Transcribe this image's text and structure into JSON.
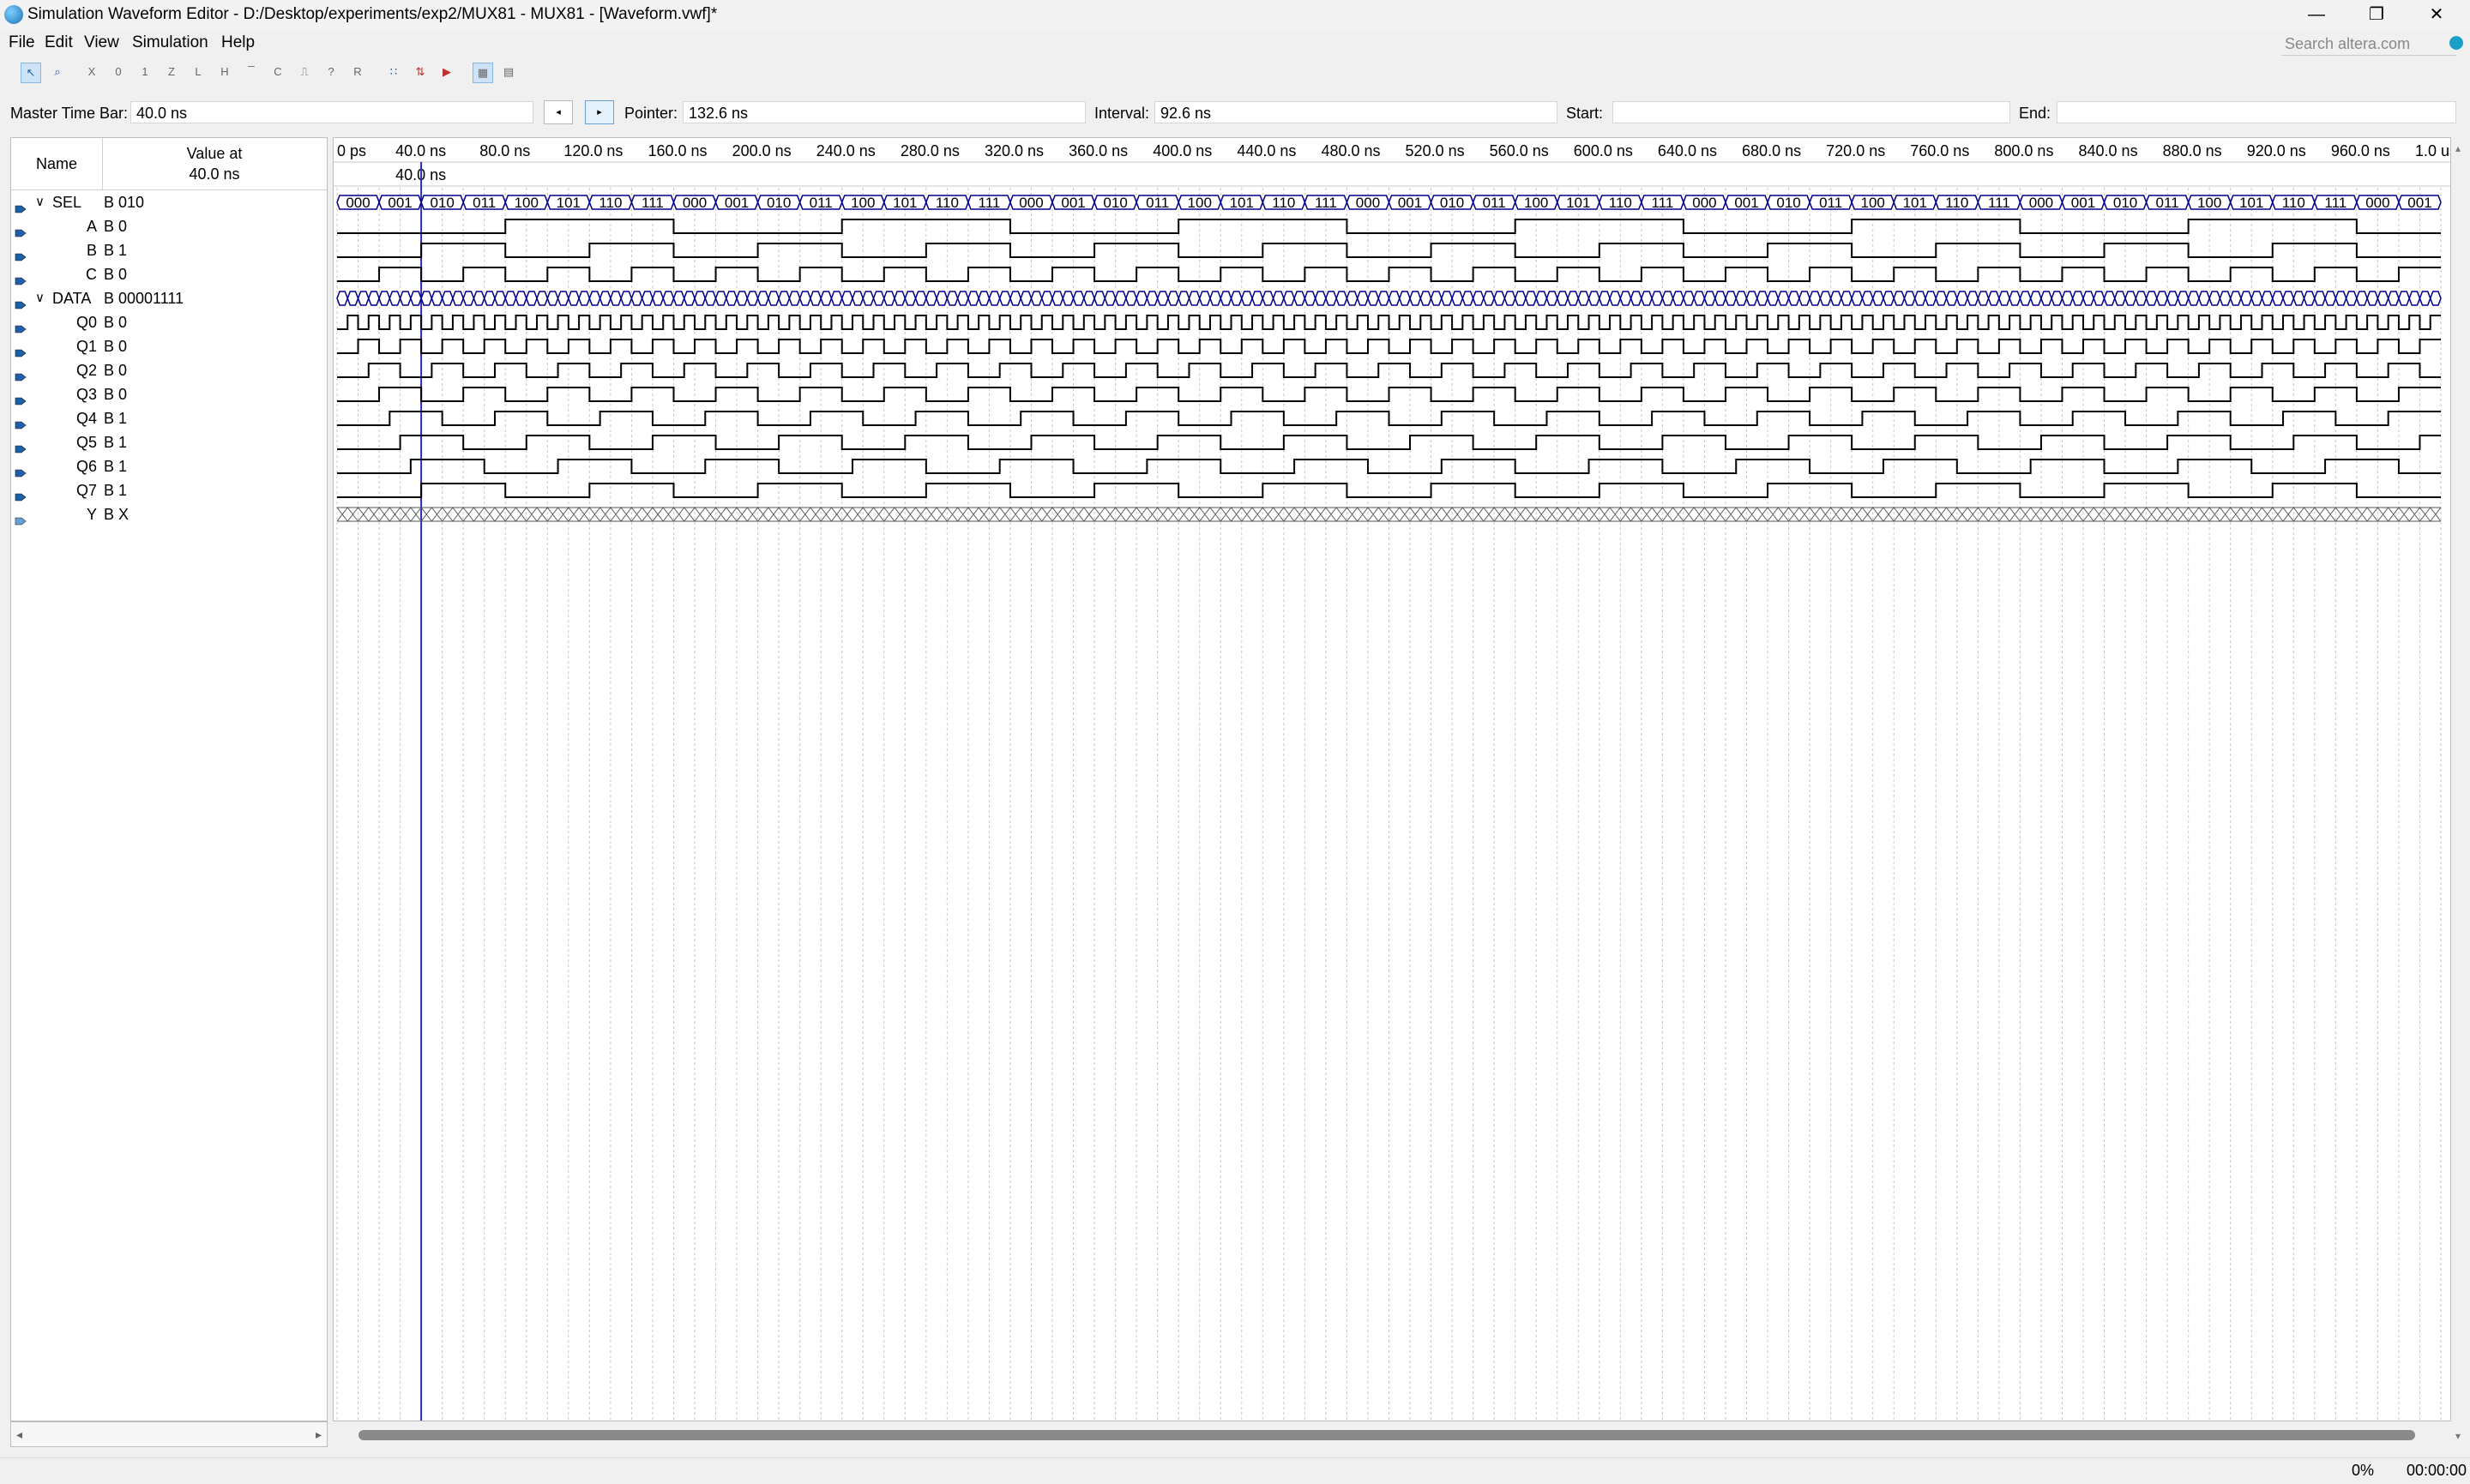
{
  "window": {
    "title": "Simulation Waveform Editor - D:/Desktop/experiments/exp2/MUX81 - MUX81 - [Waveform.vwf]*",
    "controls": [
      "—",
      "❐",
      "✕"
    ]
  },
  "menu": [
    "File",
    "Edit",
    "View",
    "Simulation",
    "Help"
  ],
  "search": {
    "placeholder": "Search altera.com"
  },
  "toolbar": {
    "icons": [
      "select-tool-icon",
      "zoom-tool-icon",
      "force-unknown-icon",
      "force-low-icon",
      "force-high-icon",
      "force-high-impedance-icon",
      "force-weak-low-icon",
      "force-weak-high-icon",
      "invert-icon",
      "count-value-icon",
      "clock-icon",
      "arbitrary-value-icon",
      "random-value-icon",
      "snap-to-grid-icon",
      "sort-icon",
      "functional-sim-icon",
      "timing-sim-icon",
      "netlist-sim-icon",
      "grid-icon",
      "group-icon"
    ]
  },
  "timebar": {
    "master_label": "Master Time Bar:",
    "master_value": "40.0 ns",
    "pointer_label": "Pointer:",
    "pointer_value": "132.6 ns",
    "interval_label": "Interval:",
    "interval_value": "92.6 ns",
    "start_label": "Start:",
    "start_value": "",
    "end_label": "End:",
    "end_value": "",
    "prev_glyph": "◂",
    "next_glyph": "▸"
  },
  "header": {
    "name": "Name",
    "value_at": "Value at",
    "value_time": "40.0 ns"
  },
  "signals": [
    {
      "name": "SEL",
      "value": "B 010",
      "group": true
    },
    {
      "name": "A",
      "value": "B 0"
    },
    {
      "name": "B",
      "value": "B 1"
    },
    {
      "name": "C",
      "value": "B 0"
    },
    {
      "name": "DATA",
      "value": "B 00001111",
      "group": true
    },
    {
      "name": "Q0",
      "value": "B 0"
    },
    {
      "name": "Q1",
      "value": "B 0"
    },
    {
      "name": "Q2",
      "value": "B 0"
    },
    {
      "name": "Q3",
      "value": "B 0"
    },
    {
      "name": "Q4",
      "value": "B 1"
    },
    {
      "name": "Q5",
      "value": "B 1"
    },
    {
      "name": "Q6",
      "value": "B 1"
    },
    {
      "name": "Q7",
      "value": "B 1"
    },
    {
      "name": "Y",
      "value": "B X"
    }
  ],
  "time_axis": {
    "labels": [
      "0 ps",
      "40.0 ns",
      "80.0 ns",
      "120.0 ns",
      "160.0 ns",
      "200.0 ns",
      "240.0 ns",
      "280.0 ns",
      "320.0 ns",
      "360.0 ns",
      "400.0 ns",
      "440.0 ns",
      "480.0 ns",
      "520.0 ns",
      "560.0 ns",
      "600.0 ns",
      "640.0 ns",
      "680.0 ns",
      "720.0 ns",
      "760.0 ns",
      "800.0 ns",
      "840.0 ns",
      "880.0 ns",
      "920.0 ns",
      "960.0 ns",
      "1.0 us"
    ],
    "cursor_label": "40.0 ns"
  },
  "sel_bus_values": [
    "000",
    "001",
    "010",
    "011",
    "100",
    "101",
    "110",
    "111",
    "000",
    "001",
    "010",
    "011",
    "100",
    "101",
    "110",
    "111",
    "000",
    "001",
    "010",
    "011",
    "100",
    "101",
    "110",
    "111",
    "000",
    "001",
    "010",
    "011",
    "100",
    "101",
    "110",
    "111",
    "000",
    "001",
    "010",
    "011",
    "100",
    "101",
    "110",
    "111",
    "000",
    "001",
    "010",
    "011",
    "100",
    "101",
    "110",
    "111",
    "000",
    "001"
  ],
  "status": {
    "progress": "0%",
    "elapsed": "00:00:00"
  },
  "colors": {
    "cursor": "#2a2ab8",
    "wave": "#000000",
    "bus_outline": "#00008b",
    "grid": "#c8c8c8"
  }
}
